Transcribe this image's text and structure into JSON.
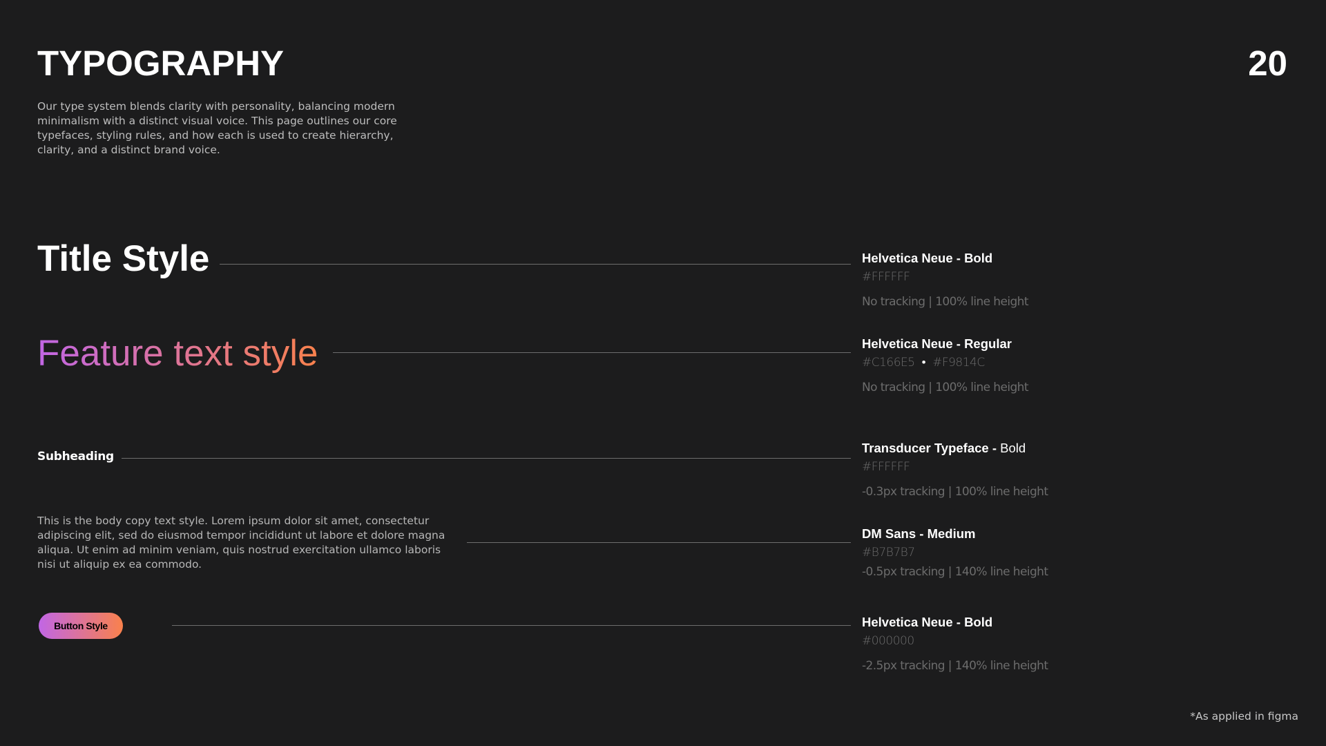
{
  "header": {
    "title": "TYPOGRAPHY",
    "page_number": "20",
    "intro": "Our type system blends clarity with personality, balancing modern minimalism with a distinct visual voice. This page outlines our core typefaces, styling rules, and how each is used to create hierarchy, clarity, and a distinct brand voice."
  },
  "samples": {
    "title": "Title Style",
    "feature": "Feature text style",
    "subheading": "Subheading",
    "body": "This is the body copy text style. Lorem ipsum dolor sit amet, consectetur adipiscing elit, sed do eiusmod tempor incididunt ut labore et dolore magna aliqua. Ut enim ad minim veniam, quis nostrud exercitation ullamco laboris nisi ut aliquip ex ea commodo.",
    "button": "Button Style"
  },
  "specs": {
    "title": {
      "name": "Helvetica Neue - Bold",
      "color": "#FFFFFF",
      "meta": "No tracking | 100% line height"
    },
    "feature": {
      "name": "Helvetica Neue -  Regular",
      "color_a": "#C166E5",
      "color_dot": "•",
      "color_b": "#F9814C",
      "meta": "No tracking | 100% line height"
    },
    "subheading": {
      "name_bold": "Transducer Typeface - ",
      "name_light": "Bold",
      "color": "#FFFFFF",
      "meta": "-0.3px tracking | 100% line height"
    },
    "body": {
      "name": "DM Sans - Medium",
      "color": "#B7B7B7",
      "meta": "-0.5px tracking | 140% line height"
    },
    "button": {
      "name": "Helvetica Neue - Bold",
      "color": "#000000",
      "meta": "-2.5px tracking | 140% line height"
    }
  },
  "footnote": "*As applied in figma",
  "colors": {
    "background": "#1c1c1d",
    "gradient_start": "#C166E5",
    "gradient_end": "#F9814C",
    "body_text": "#B7B7B7"
  }
}
